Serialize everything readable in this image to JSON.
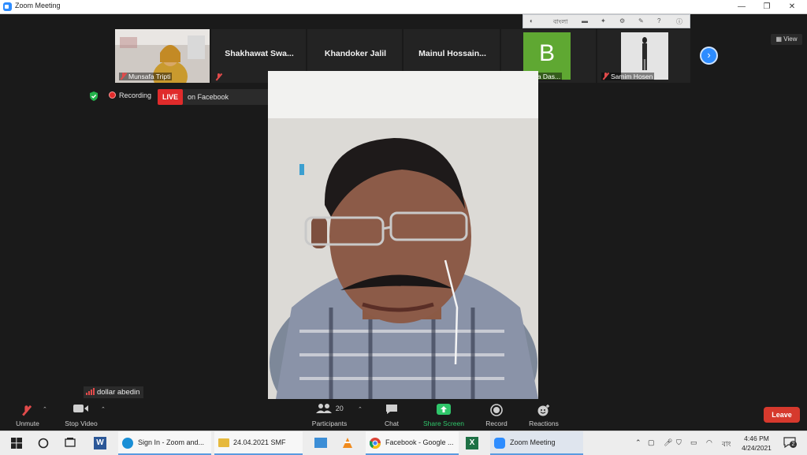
{
  "window": {
    "title": "Zoom Meeting",
    "minimize": "—",
    "restore": "❐",
    "close": "✕"
  },
  "view_button": "View",
  "language_bar": {
    "lang": "বাংলা"
  },
  "gallery": [
    {
      "id": "munsafa",
      "label": "Munsafa Tripti",
      "kind": "video"
    },
    {
      "id": "shakhawat",
      "name": "Shakhawat  Swa...",
      "kind": "name"
    },
    {
      "id": "khandoker",
      "name": "Khandoker Jalil",
      "kind": "name"
    },
    {
      "id": "mainul",
      "name": "Mainul  Hossain...",
      "kind": "name"
    },
    {
      "id": "banalata",
      "label": "Banalata Das...",
      "kind": "initial",
      "initial": "B",
      "color": "#5fa832"
    },
    {
      "id": "samim",
      "label": "Samim Hosen",
      "kind": "video"
    }
  ],
  "status": {
    "recording": "Recording",
    "live_badge": "LIVE",
    "destination": "on Facebook"
  },
  "speaker": {
    "name": "dollar abedin"
  },
  "controls": {
    "unmute": "Unmute",
    "stop_video": "Stop Video",
    "participants": "Participants",
    "participants_count": "20",
    "chat": "Chat",
    "share_screen": "Share Screen",
    "record": "Record",
    "reactions": "Reactions",
    "leave": "Leave"
  },
  "taskbar": {
    "items": [
      {
        "id": "signin",
        "label": "Sign In - Zoom and..."
      },
      {
        "id": "folder",
        "label": "24.04.2021 SMF"
      },
      {
        "id": "facebook",
        "label": "Facebook - Google ..."
      },
      {
        "id": "zoom",
        "label": "Zoom Meeting"
      }
    ],
    "time": "4:46 PM",
    "date": "4/24/2021",
    "lang": "বাং",
    "notifications": "2"
  },
  "colors": {
    "accent": "#2d8cff",
    "live": "#e02b2b",
    "share": "#2fc66a",
    "leave": "#d6392d"
  }
}
